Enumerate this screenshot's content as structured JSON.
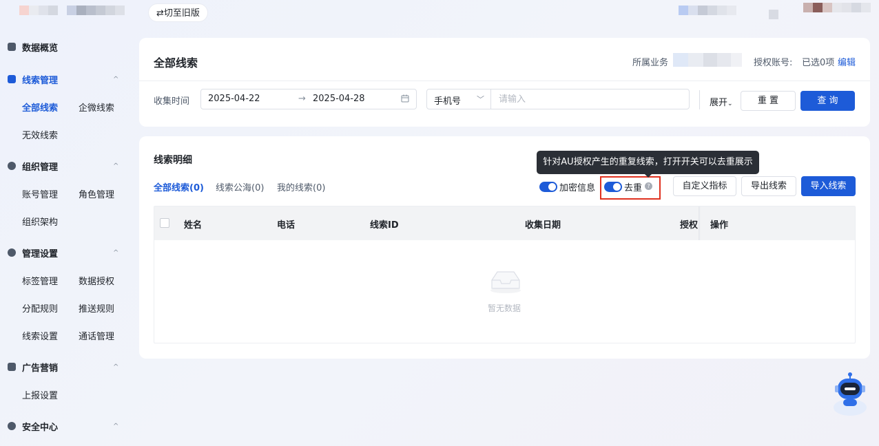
{
  "topbar": {
    "switch_label": "⇄切至旧版"
  },
  "sidebar": {
    "groups": [
      {
        "label": "数据概览"
      },
      {
        "label": "线索管理",
        "items": [
          "全部线索",
          "企微线索",
          "无效线索"
        ]
      },
      {
        "label": "组织管理",
        "items": [
          "账号管理",
          "角色管理",
          "组织架构"
        ]
      },
      {
        "label": "管理设置",
        "items": [
          "标签管理",
          "数据授权",
          "分配规则",
          "推送规则",
          "线索设置",
          "通话管理"
        ]
      },
      {
        "label": "广告营销",
        "items": [
          "上报设置"
        ]
      },
      {
        "label": "安全中心"
      }
    ],
    "chevron": "^"
  },
  "filter": {
    "title": "全部线索",
    "business_label": "所属业务",
    "account_label": "授权账号:",
    "account_value": "已选0项",
    "edit_link": "编辑",
    "time_label": "收集时间",
    "date_start": "2025-04-22",
    "date_sep": "→",
    "date_end": "2025-04-28",
    "field_select": "手机号",
    "input_placeholder": "请输入",
    "expand": "展开",
    "reset": "重 置",
    "query": "查 询"
  },
  "detail": {
    "title": "线索明细",
    "tabs": [
      "全部线索(0)",
      "线索公海(0)",
      "我的线索(0)"
    ],
    "encrypt_label": "加密信息",
    "dedupe_label": "去重",
    "tooltip": "针对AU授权产生的重复线索，打开开关可以去重展示",
    "custom_metrics": "自定义指标",
    "export": "导出线索",
    "import": "导入线索",
    "columns": [
      "姓名",
      "电话",
      "线索ID",
      "收集日期",
      "授权",
      "操作"
    ],
    "empty_text": "暂无数据"
  },
  "colors": {
    "accent": "#1d5bd8",
    "highlight_box": "#e0301e"
  }
}
